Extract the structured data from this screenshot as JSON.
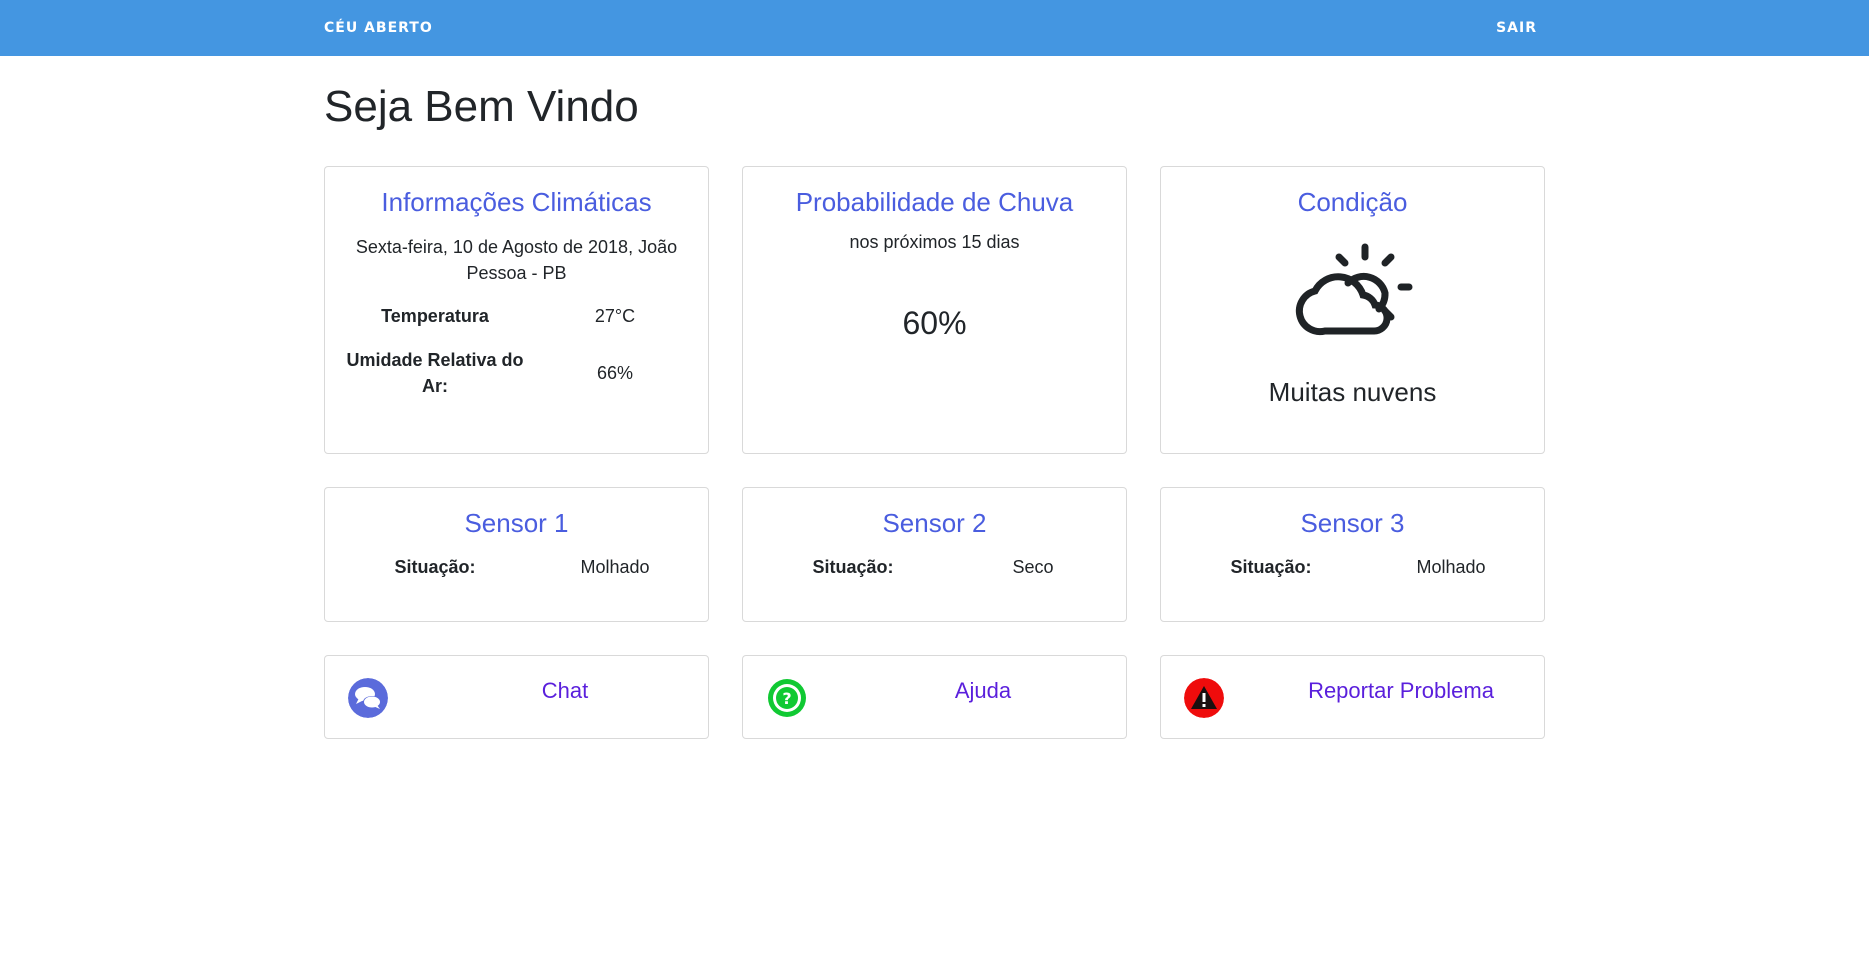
{
  "navbar": {
    "brand": "CÉU ABERTO",
    "logout": "SAIR",
    "color": "#4496e1"
  },
  "page": {
    "title": "Seja Bem Vindo"
  },
  "climate": {
    "title": "Informações Climáticas",
    "date_location": "Sexta-feira, 10 de Agosto de 2018, João Pessoa - PB",
    "temperature_label": "Temperatura",
    "temperature_value": "27°C",
    "humidity_label": "Umidade Relativa do Ar:",
    "humidity_value": "66%"
  },
  "rain": {
    "title": "Probabilidade de Chuva",
    "subtitle": "nos próximos 15 dias",
    "value": "60%"
  },
  "condition": {
    "title": "Condição",
    "icon": "partly-cloudy-icon",
    "text": "Muitas nuvens"
  },
  "sensors": [
    {
      "title": "Sensor 1",
      "status_label": "Situação:",
      "status_value": "Molhado"
    },
    {
      "title": "Sensor 2",
      "status_label": "Situação:",
      "status_value": "Seco"
    },
    {
      "title": "Sensor 3",
      "status_label": "Situação:",
      "status_value": "Molhado"
    }
  ],
  "actions": [
    {
      "label": "Chat",
      "icon": "chat-icon",
      "color": "#5b6bdb"
    },
    {
      "label": "Ajuda",
      "icon": "help-icon",
      "color": "#10c933"
    },
    {
      "label": "Reportar Problema",
      "icon": "warning-icon",
      "color": "#ef0c0c"
    }
  ],
  "colors": {
    "title_accent": "#4a5ddf",
    "link": "#5a1fdc"
  }
}
